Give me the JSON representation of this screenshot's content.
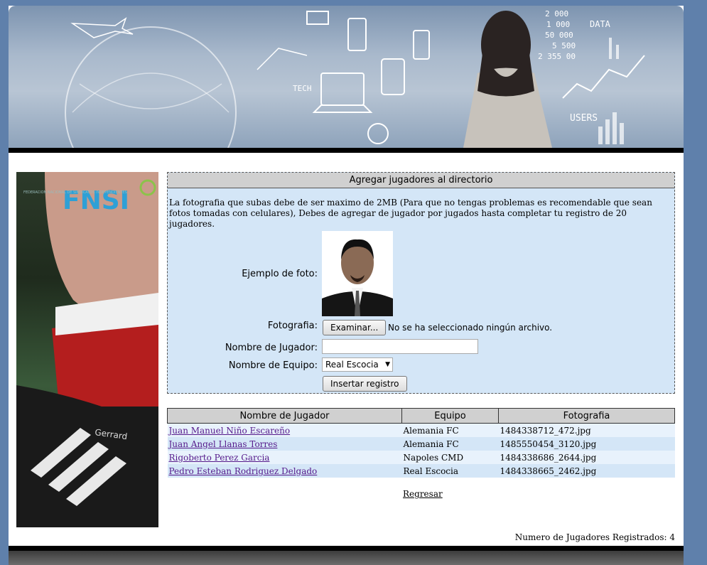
{
  "banner": {
    "words": [
      "TECH",
      "DATA",
      "USERS",
      "2 000",
      "1 000",
      "50 000",
      "5 500",
      "2 355 00"
    ]
  },
  "logo": {
    "text": "FNSI",
    "small_text": "FEDERACION NACIONAL DE SINDICATOS INDEPENDIENTES"
  },
  "boot_text": "Gerrard",
  "form": {
    "title": "Agregar jugadores al directorio",
    "intro": "La fotografia que subas debe de ser maximo de 2MB (Para que no tengas problemas es recomendable que sean fotos tomadas con celulares), Debes de agregar de jugador por jugados hasta completar tu registro de 20 jugadores.",
    "photo_example_label": "Ejemplo de foto:",
    "photo_label": "Fotografia:",
    "browse_button": "Examinar...",
    "no_file_text": "No se ha seleccionado ningún archivo.",
    "player_name_label": "Nombre de Jugador:",
    "player_name_value": "",
    "team_label": "Nombre de Equipo:",
    "team_selected": "Real Escocia",
    "submit_button": "Insertar registro"
  },
  "table": {
    "headers": [
      "Nombre de Jugador",
      "Equipo",
      "Fotografia"
    ],
    "rows": [
      {
        "name": "Juan Manuel Niño Escareño",
        "team": "Alemania FC",
        "photo": "1484338712_472.jpg"
      },
      {
        "name": "Juan Angel Llanas Torres",
        "team": "Alemania FC",
        "photo": "1485550454_3120.jpg"
      },
      {
        "name": "Rigoberto Perez Garcia",
        "team": "Napoles CMD",
        "photo": "1484338686_2644.jpg"
      },
      {
        "name": "Pedro Esteban Rodriguez Delgado",
        "team": "Real Escocia",
        "photo": "1484338665_2462.jpg"
      }
    ]
  },
  "back_link": "Regresar",
  "count_text": "Numero de Jugadores Registrados: 4"
}
